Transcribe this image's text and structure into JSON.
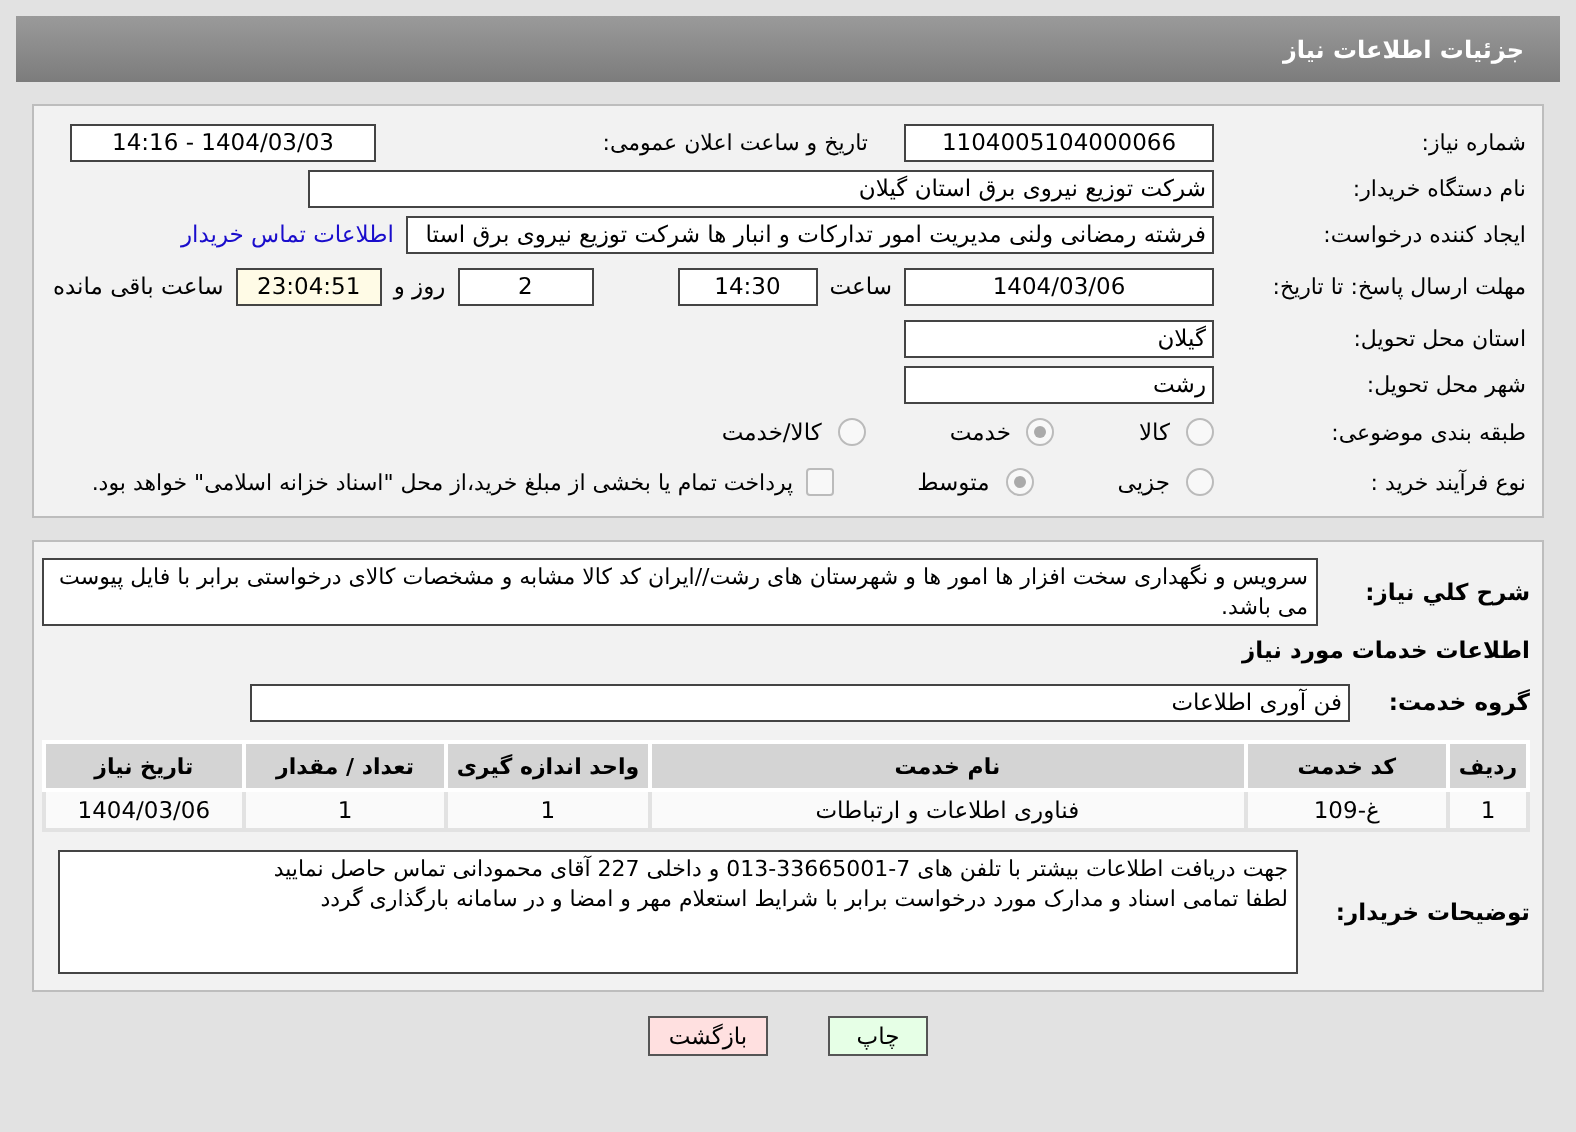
{
  "header": {
    "title": "جزئیات اطلاعات نیاز"
  },
  "need_number": {
    "label": "شماره نیاز:",
    "value": "1104005104000066"
  },
  "announce": {
    "label": "تاریخ و ساعت اعلان عمومی:",
    "value": "1404/03/03 - 14:16"
  },
  "buyer": {
    "label": "نام دستگاه خریدار:",
    "value": "شرکت توزیع نیروی برق استان گیلان"
  },
  "creator": {
    "label": "ایجاد کننده درخواست:",
    "value": "فرشته رمضانی ولنی مدیریت امور تدارکات و انبار ها شرکت توزیع نیروی برق استا",
    "link": "اطلاعات تماس خریدار"
  },
  "deadline": {
    "label": "مهلت ارسال پاسخ: تا تاریخ:",
    "date": "1404/03/06",
    "time_label": "ساعت",
    "time": "14:30",
    "days": "2",
    "days_label": "روز و",
    "remaining": "23:04:51",
    "remaining_label": "ساعت باقی مانده"
  },
  "province": {
    "label": "استان محل تحویل:",
    "value": "گیلان"
  },
  "city": {
    "label": "شهر محل تحویل:",
    "value": "رشت"
  },
  "category": {
    "label": "طبقه بندی موضوعی:",
    "options": [
      {
        "label": "کالا",
        "selected": false
      },
      {
        "label": "خدمت",
        "selected": true
      },
      {
        "label": "کالا/خدمت",
        "selected": false
      }
    ]
  },
  "process": {
    "label": "نوع فرآیند خرید :",
    "options": [
      {
        "label": "جزیی",
        "selected": false
      },
      {
        "label": "متوسط",
        "selected": true
      }
    ],
    "checkbox": {
      "label": "پرداخت تمام یا بخشی از مبلغ خرید،از محل \"اسناد خزانه اسلامی\" خواهد بود.",
      "checked": false
    }
  },
  "description": {
    "label": "شرح کلي نياز:",
    "value": "سرويس و نگهداری سخت افزار ها امور ها و شهرستان های رشت//ایران کد کالا مشابه و مشخصات کالای درخواستی برابر با فایل پیوست می باشد."
  },
  "services_title": "اطلاعات خدمات مورد نیاز",
  "service_group": {
    "label": "گروه خدمت:",
    "value": "فن آوری اطلاعات"
  },
  "table": {
    "columns": [
      "ردیف",
      "کد خدمت",
      "نام خدمت",
      "واحد اندازه گیری",
      "تعداد / مقدار",
      "تاریخ نیاز"
    ],
    "rows": [
      [
        "1",
        "غ-109",
        "فناوری اطلاعات و ارتباطات",
        "1",
        "1",
        "1404/03/06"
      ]
    ]
  },
  "notes": {
    "label": "توضیحات خریدار:",
    "lines": [
      "جهت دریافت اطلاعات بیشتر با تلفن های 7-33665001-013 و داخلی 227 آقای محمودانی تماس حاصل نمایید",
      "لطفا تمامی اسناد و مدارک مورد درخواست برابر با شرایط استعلام مهر و امضا و در سامانه بارگذاری گردد"
    ]
  },
  "buttons": [
    {
      "label": "چاپ",
      "kind": "print"
    },
    {
      "label": "بازگشت",
      "kind": "back"
    }
  ]
}
